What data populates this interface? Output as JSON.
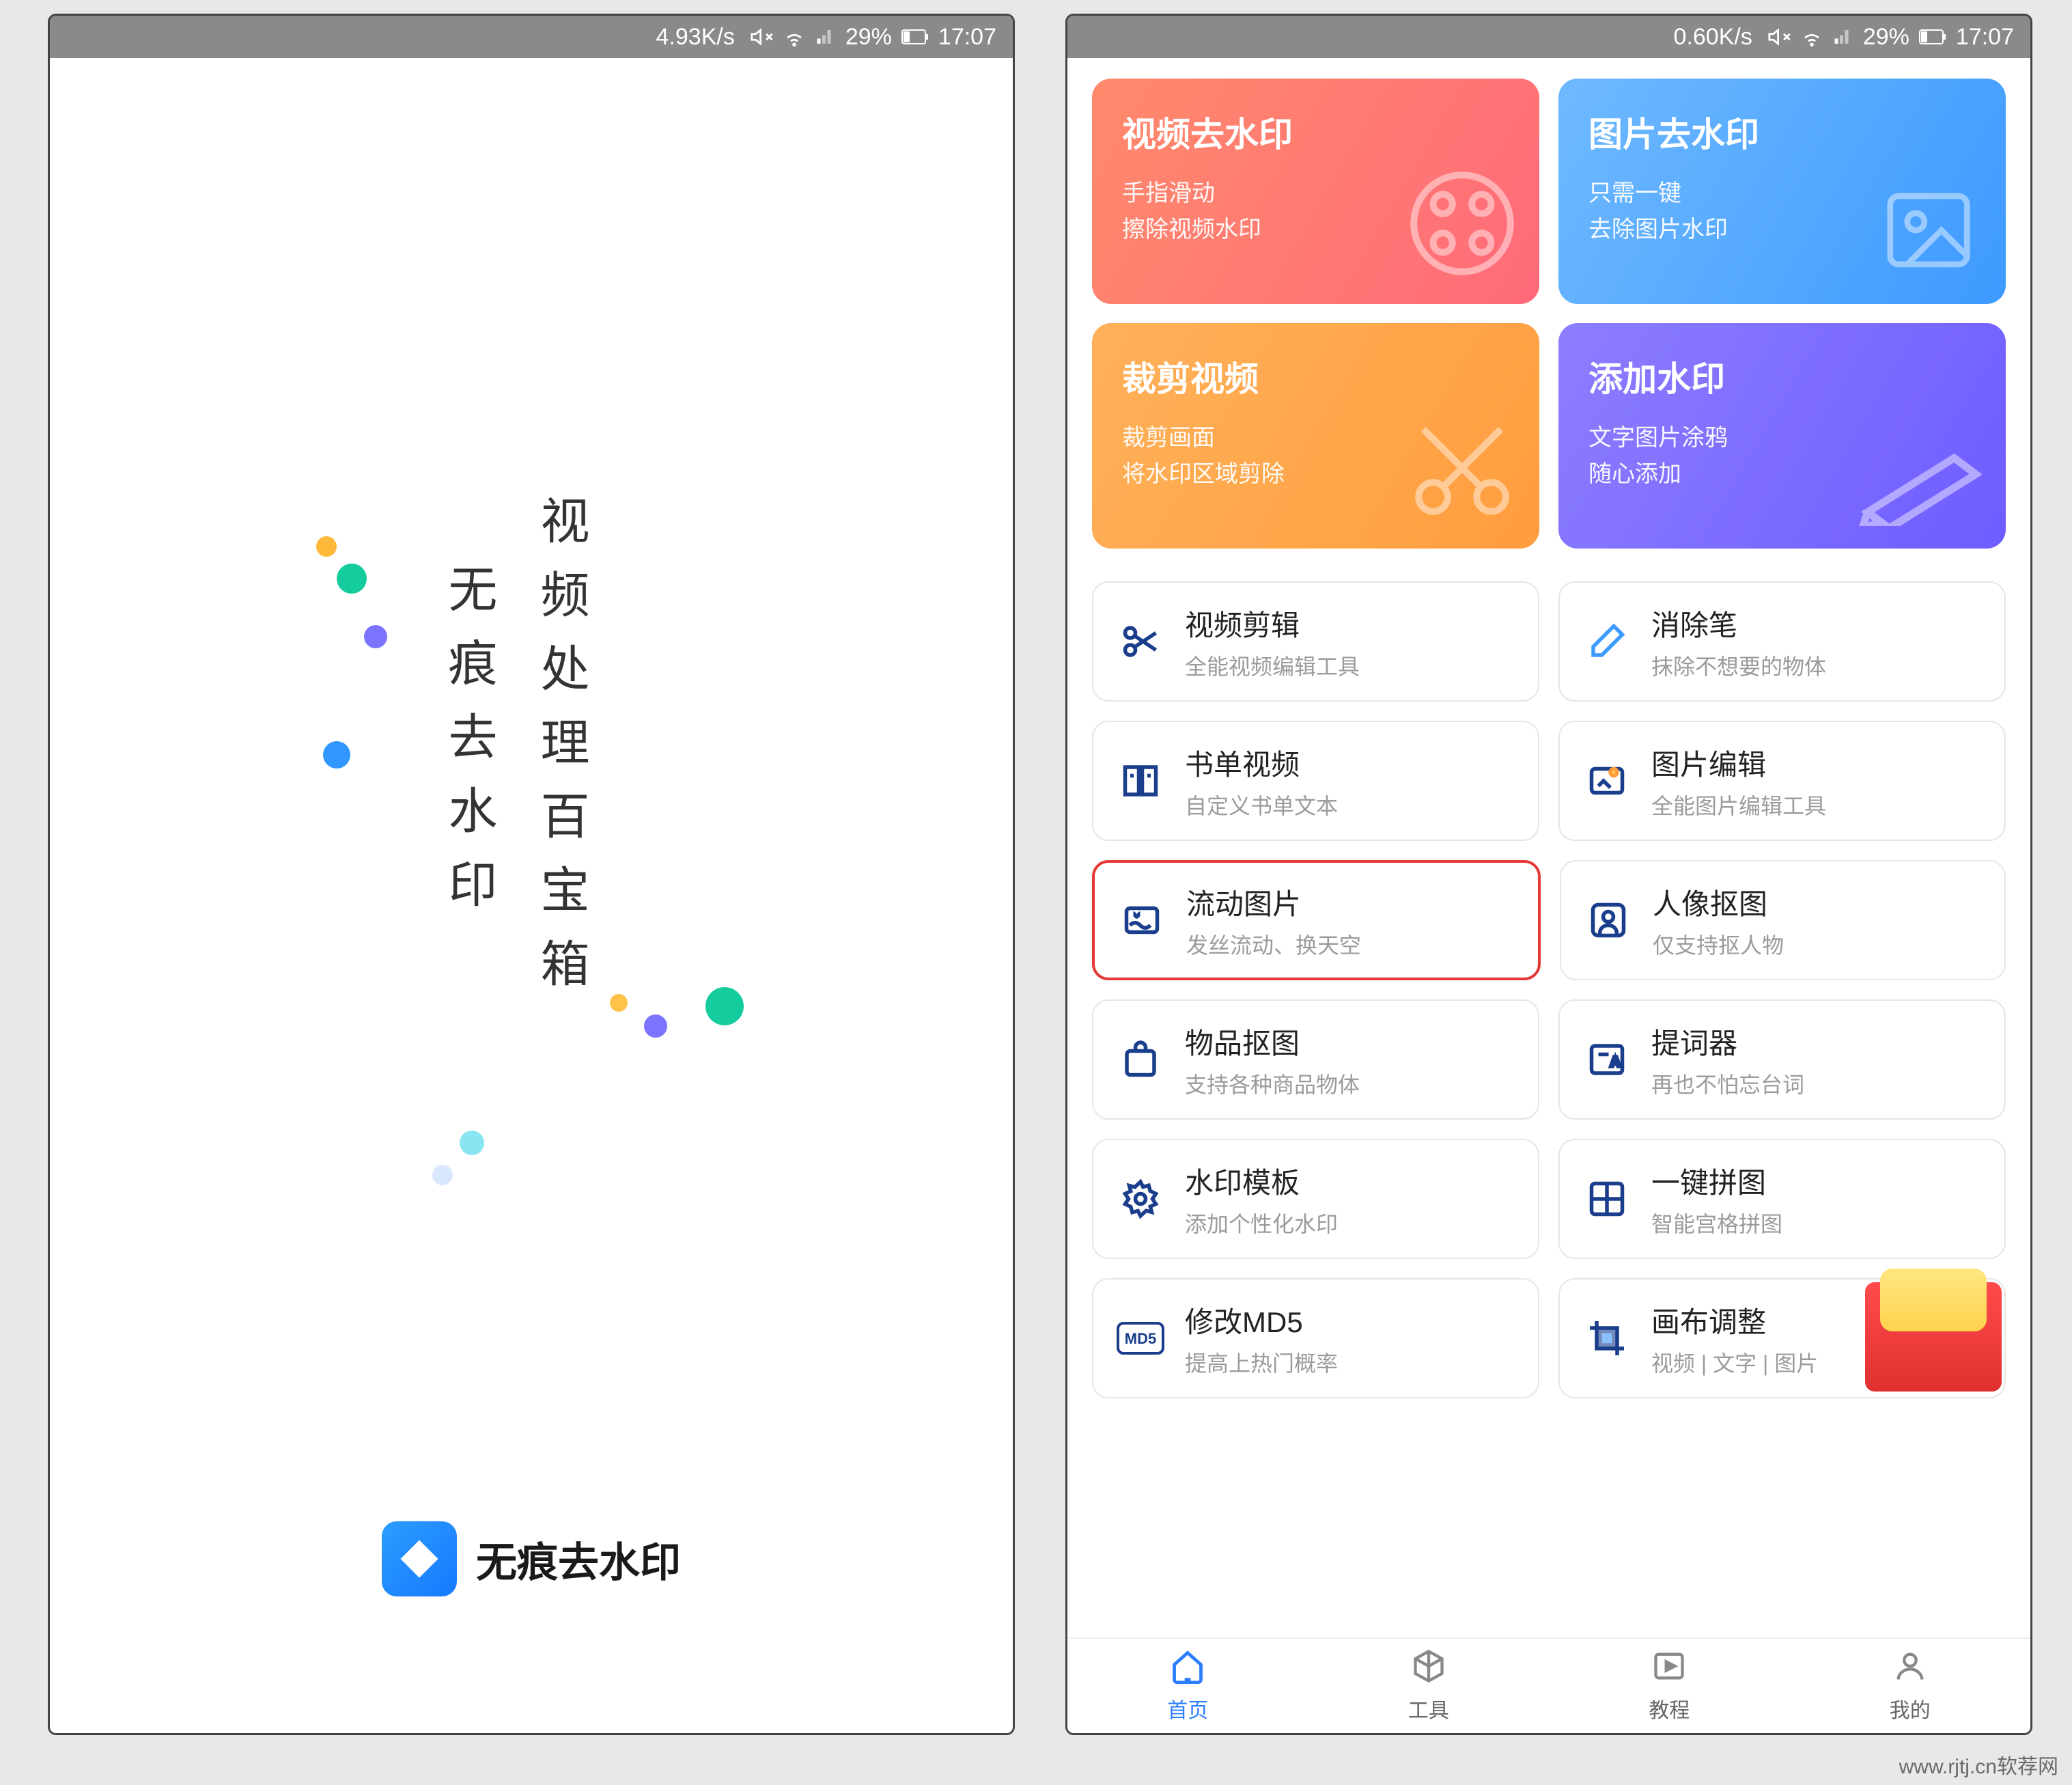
{
  "statusbar_left": {
    "speed": "4.93K/s",
    "battery": "29%",
    "time": "17:07"
  },
  "statusbar_right": {
    "speed": "0.60K/s",
    "battery": "29%",
    "time": "17:07"
  },
  "splash": {
    "line1": "视频处理百宝箱",
    "line2": "无痕去水印",
    "brand": "无痕去水印"
  },
  "big_cards": [
    {
      "title": "视频去水印",
      "line1": "手指滑动",
      "line2": "擦除视频水印"
    },
    {
      "title": "图片去水印",
      "line1": "只需一键",
      "line2": "去除图片水印"
    },
    {
      "title": "裁剪视频",
      "line1": "裁剪画面",
      "line2": "将水印区域剪除"
    },
    {
      "title": "添加水印",
      "line1": "文字图片涂鸦",
      "line2": "随心添加"
    }
  ],
  "tools": [
    {
      "title": "视频剪辑",
      "sub": "全能视频编辑工具"
    },
    {
      "title": "消除笔",
      "sub": "抹除不想要的物体"
    },
    {
      "title": "书单视频",
      "sub": "自定义书单文本"
    },
    {
      "title": "图片编辑",
      "sub": "全能图片编辑工具"
    },
    {
      "title": "流动图片",
      "sub": "发丝流动、换天空"
    },
    {
      "title": "人像抠图",
      "sub": "仅支持抠人物"
    },
    {
      "title": "物品抠图",
      "sub": "支持各种商品物体"
    },
    {
      "title": "提词器",
      "sub": "再也不怕忘台词"
    },
    {
      "title": "水印模板",
      "sub": "添加个性化水印"
    },
    {
      "title": "一键拼图",
      "sub": "智能宫格拼图"
    },
    {
      "title": "修改MD5",
      "sub": "提高上热门概率"
    },
    {
      "title": "画布调整",
      "sub": "视频 | 文字 | 图片"
    }
  ],
  "nav": [
    {
      "label": "首页"
    },
    {
      "label": "工具"
    },
    {
      "label": "教程"
    },
    {
      "label": "我的"
    }
  ],
  "watermark": "www.rjtj.cn软荐网"
}
